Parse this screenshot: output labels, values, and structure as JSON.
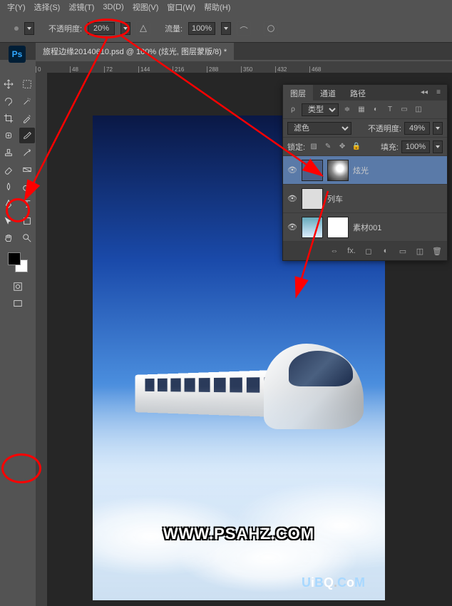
{
  "menu": {
    "items": [
      "字(Y)",
      "选择(S)",
      "滤镜(T)",
      "3D(D)",
      "视图(V)",
      "窗口(W)",
      "帮助(H)"
    ]
  },
  "optbar": {
    "opacity_label": "不透明度:",
    "opacity_value": "20%",
    "flow_label": "流量:",
    "flow_value": "100%"
  },
  "tab": {
    "title": "旅程边缘20140610.psd @ 100% (炫光, 图层蒙版/8) *"
  },
  "ruler": {
    "marks": [
      "0",
      "48",
      "72",
      "144",
      "216",
      "288",
      "350",
      "432",
      "468"
    ]
  },
  "panel": {
    "tabs": [
      "图层",
      "通道",
      "路径"
    ],
    "kind_label": "类型",
    "blend_mode": "滤色",
    "opacity_label": "不透明度:",
    "opacity_value": "49%",
    "lock_label": "锁定:",
    "fill_label": "填充:",
    "fill_value": "100%",
    "layers": [
      {
        "name": "炫光",
        "visible": true,
        "selected": true,
        "has_mask": true
      },
      {
        "name": "列车",
        "visible": true,
        "selected": false,
        "has_mask": false
      },
      {
        "name": "素材001",
        "visible": true,
        "selected": false,
        "has_mask": true
      }
    ],
    "fx_label": "fx."
  },
  "canvas": {
    "watermark": "WWW.PSAHZ.COM",
    "watermark2": "UiBQ.CoM"
  }
}
